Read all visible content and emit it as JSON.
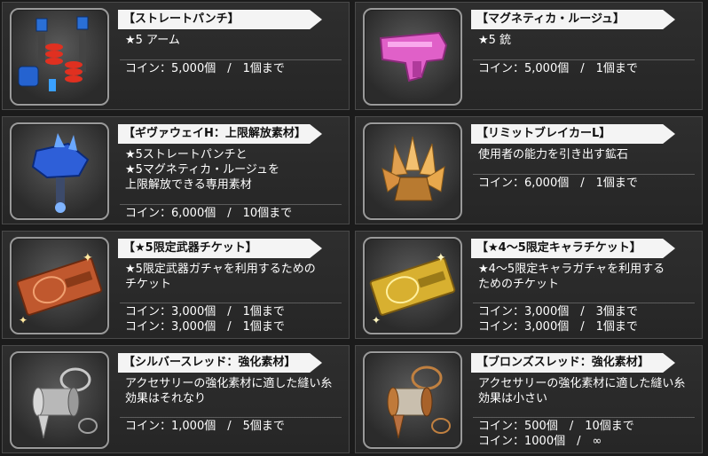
{
  "items": [
    {
      "title": "【ストレートパンチ】",
      "desc": "★5 アーム",
      "costs": [
        "コイン：5,000個　/　1個まで"
      ],
      "icon": "robot-arm-icon"
    },
    {
      "title": "【マグネティカ・ルージュ】",
      "desc": "★5 銃",
      "costs": [
        "コイン：5,000個　/　1個まで"
      ],
      "icon": "pink-gun-icon"
    },
    {
      "title": "【ギヴァウェイH：上限解放素材】",
      "desc": "★5ストレートパンチと\n★5マグネティカ・ルージュを\n上限解放できる専用素材",
      "costs": [
        "コイン：6,000個　/　10個まで"
      ],
      "icon": "blue-claw-icon"
    },
    {
      "title": "【リミットブレイカーL】",
      "desc": "使用者の能力を引き出す鉱石",
      "costs": [
        "コイン：6,000個　/　1個まで"
      ],
      "icon": "crystal-ore-icon"
    },
    {
      "title": "【★5限定武器チケット】",
      "desc": "★5限定武器ガチャを利用するための\nチケット",
      "costs": [
        "コイン：3,000個　/　1個まで",
        "コイン：3,000個　/　1個まで"
      ],
      "icon": "bronze-ticket-icon"
    },
    {
      "title": "【★4～5限定キャラチケット】",
      "desc": "★4～5限定キャラガチャを利用する\nためのチケット",
      "costs": [
        "コイン：3,000個　/　3個まで",
        "コイン：3,000個　/　1個まで"
      ],
      "icon": "gold-ticket-icon"
    },
    {
      "title": "【シルバースレッド：強化素材】",
      "desc": "アクセサリーの強化素材に適した縫い糸\n効果はそれなり",
      "costs": [
        "コイン：1,000個　/　5個まで"
      ],
      "icon": "silver-spool-icon"
    },
    {
      "title": "【ブロンズスレッド：強化素材】",
      "desc": "アクセサリーの強化素材に適した縫い糸\n効果は小さい",
      "costs": [
        "コイン：500個　/　10個まで",
        "コイン：1000個　/　∞"
      ],
      "icon": "bronze-spool-icon"
    }
  ]
}
